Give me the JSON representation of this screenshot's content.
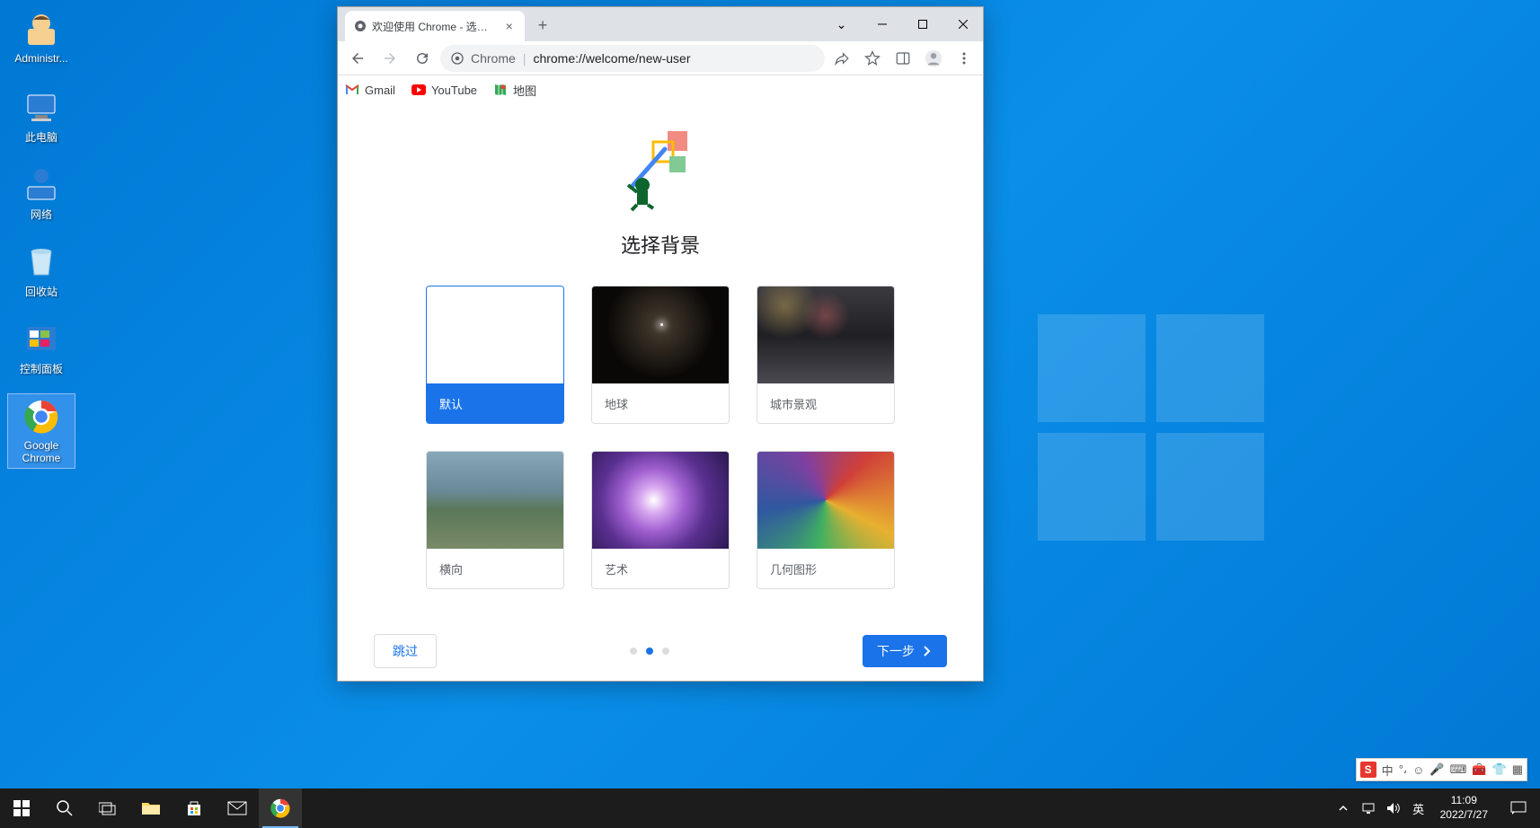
{
  "desktop": {
    "icons": [
      {
        "label": "Administr...",
        "name": "user-admin"
      },
      {
        "label": "此电脑",
        "name": "this-pc"
      },
      {
        "label": "网络",
        "name": "network"
      },
      {
        "label": "回收站",
        "name": "recycle-bin"
      },
      {
        "label": "控制面板",
        "name": "control-panel"
      },
      {
        "label": "Google Chrome",
        "name": "google-chrome"
      }
    ]
  },
  "chrome": {
    "tab_title": "欢迎使用 Chrome - 选择背景",
    "url_prefix": "Chrome",
    "url_path": "chrome://welcome/new-user",
    "bookmarks": [
      {
        "label": "Gmail",
        "name": "gmail"
      },
      {
        "label": "YouTube",
        "name": "youtube"
      },
      {
        "label": "地图",
        "name": "maps"
      }
    ],
    "page": {
      "heading": "选择背景",
      "cards": [
        {
          "label": "默认",
          "name": "default",
          "selected": true
        },
        {
          "label": "地球",
          "name": "earth",
          "selected": false
        },
        {
          "label": "城市景观",
          "name": "cityscape",
          "selected": false
        },
        {
          "label": "横向",
          "name": "landscape",
          "selected": false
        },
        {
          "label": "艺术",
          "name": "art",
          "selected": false
        },
        {
          "label": "几何图形",
          "name": "geometric",
          "selected": false
        }
      ],
      "skip_label": "跳过",
      "next_label": "下一步",
      "active_dot": 1,
      "total_dots": 3
    }
  },
  "ime": {
    "lang": "中",
    "icons": [
      "punct",
      "face",
      "mic",
      "keyboard",
      "toolbox",
      "shirt",
      "menu"
    ]
  },
  "taskbar": {
    "tray_lang": "英",
    "time": "11:09",
    "date": "2022/7/27"
  }
}
